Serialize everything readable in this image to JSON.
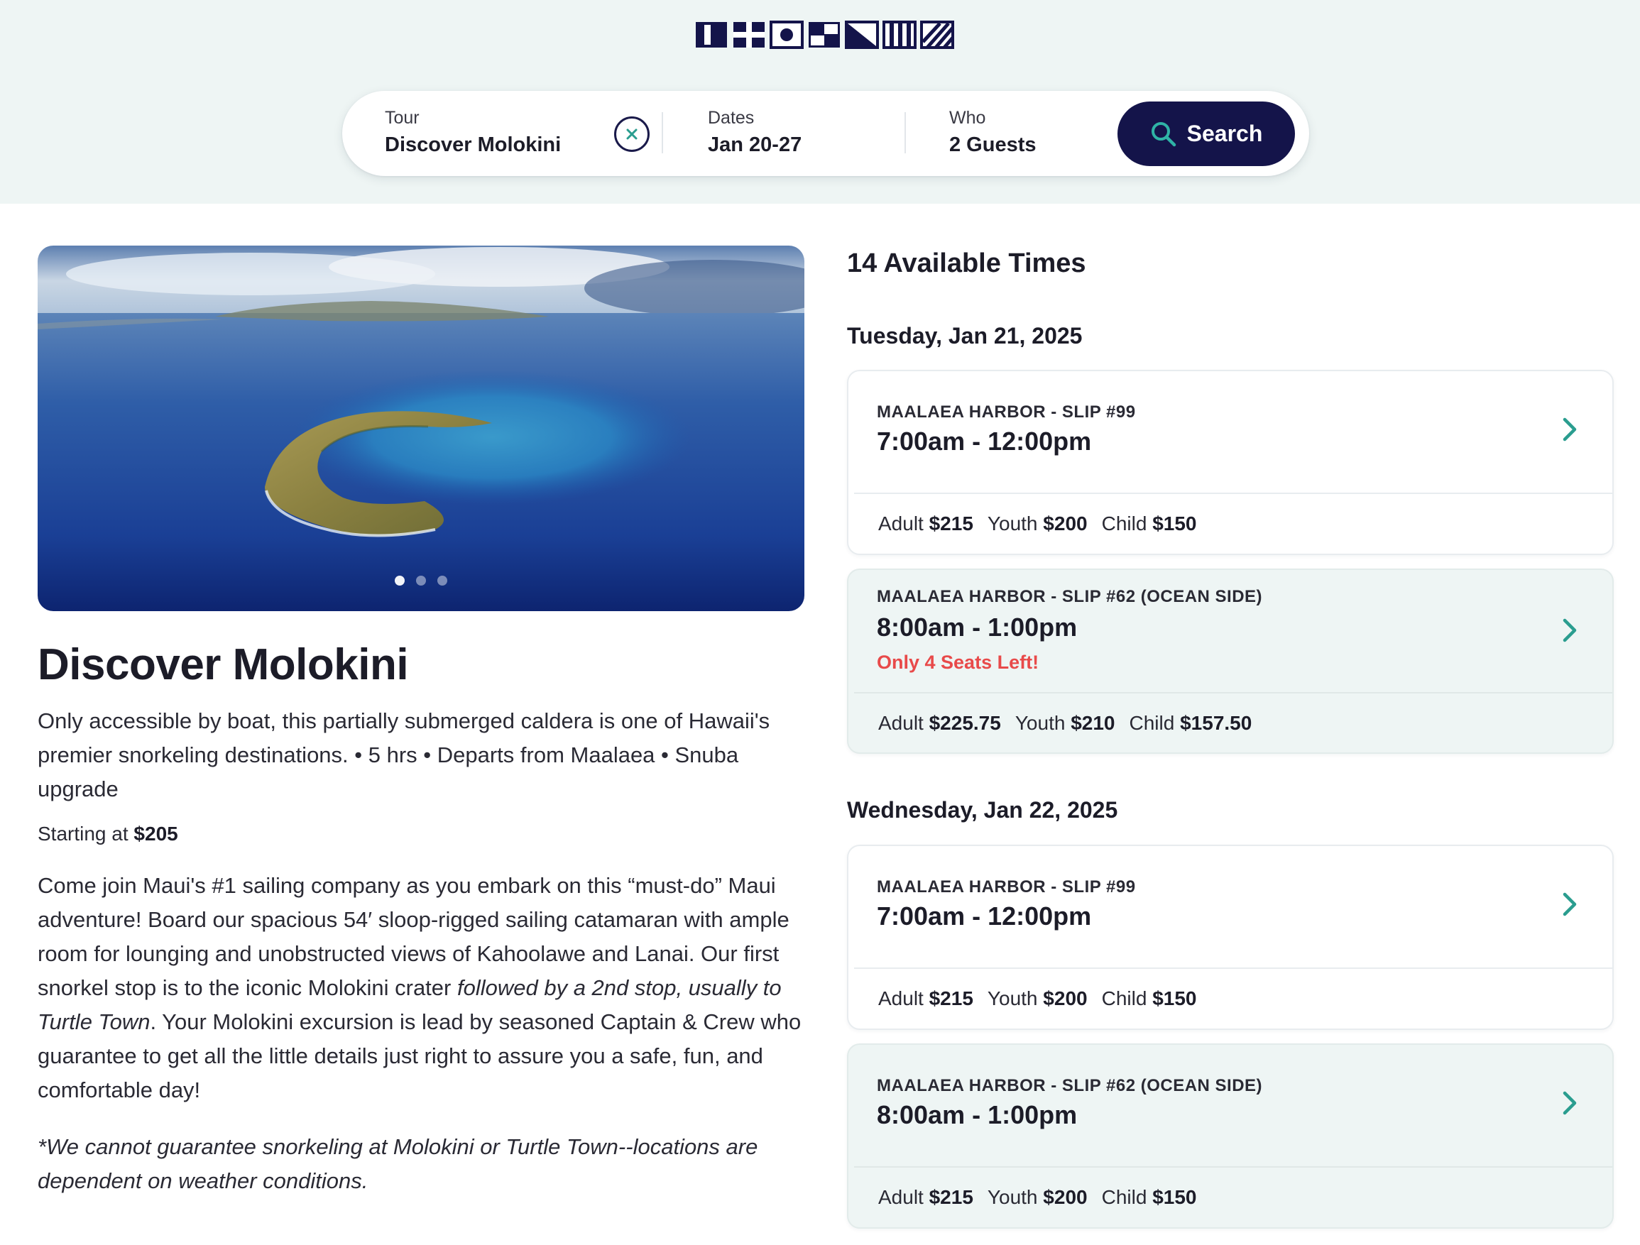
{
  "header": {
    "logo_icon": "nautical-signal-flags-logo",
    "search": {
      "tour_label": "Tour",
      "tour_value": "Discover Molokini",
      "clear_icon": "close-circle-icon",
      "dates_label": "Dates",
      "dates_value": "Jan 20-27",
      "who_label": "Who",
      "who_value": "2 Guests",
      "button_label": "Search",
      "button_icon": "search-icon"
    }
  },
  "colors": {
    "navy": "#14144a",
    "teal": "#2a9d8f",
    "header_bg": "#eef5f4",
    "alert": "#e84a4a"
  },
  "tour": {
    "carousel_total": 3,
    "carousel_active": 1,
    "title": "Discover Molokini",
    "summary": "Only accessible by boat, this partially submerged caldera is one of Hawaii's premier snorkeling destinations. • 5 hrs • Departs from Maalaea • Snuba upgrade",
    "starting_label": "Starting at",
    "starting_price": "$205",
    "desc_part1": "Come join Maui's #1 sailing company as you embark on this “must-do” Maui adventure! Board our spacious 54′ sloop-rigged sailing catamaran with ample room for lounging and unobstructed views of Kahoolawe and Lanai. Our first snorkel stop is to the iconic Molokini crater",
    "desc_italic": "followed by a 2nd stop, usually to Turtle Town",
    "desc_part2": ". Your Molokini excursion is lead by seasoned Captain & Crew who guarantee to get all the little details just right to assure you a safe, fun, and comfortable day!",
    "note": "*We cannot guarantee snorkeling at Molokini or Turtle Town--locations are dependent on weather conditions."
  },
  "availability": {
    "title": "14 Available Times",
    "days": [
      {
        "heading": "Tuesday, Jan 21, 2025",
        "slots": [
          {
            "location": "MAALAEA HARBOR - SLIP #99",
            "time": "7:00am - 12:00pm",
            "alert": "",
            "adult_label": "Adult",
            "adult_price": "$215",
            "youth_label": "Youth",
            "youth_price": "$200",
            "child_label": "Child",
            "child_price": "$150"
          },
          {
            "location": "MAALAEA HARBOR - SLIP #62 (OCEAN SIDE)",
            "time": "8:00am - 1:00pm",
            "alert": "Only 4 Seats Left!",
            "adult_label": "Adult",
            "adult_price": "$225.75",
            "youth_label": "Youth",
            "youth_price": "$210",
            "child_label": "Child",
            "child_price": "$157.50"
          }
        ]
      },
      {
        "heading": "Wednesday, Jan 22, 2025",
        "slots": [
          {
            "location": "MAALAEA HARBOR - SLIP #99",
            "time": "7:00am - 12:00pm",
            "alert": "",
            "adult_label": "Adult",
            "adult_price": "$215",
            "youth_label": "Youth",
            "youth_price": "$200",
            "child_label": "Child",
            "child_price": "$150"
          },
          {
            "location": "MAALAEA HARBOR - SLIP #62 (OCEAN SIDE)",
            "time": "8:00am - 1:00pm",
            "alert": "",
            "adult_label": "Adult",
            "adult_price": "$215",
            "youth_label": "Youth",
            "youth_price": "$200",
            "child_label": "Child",
            "child_price": "$150"
          }
        ]
      }
    ]
  }
}
